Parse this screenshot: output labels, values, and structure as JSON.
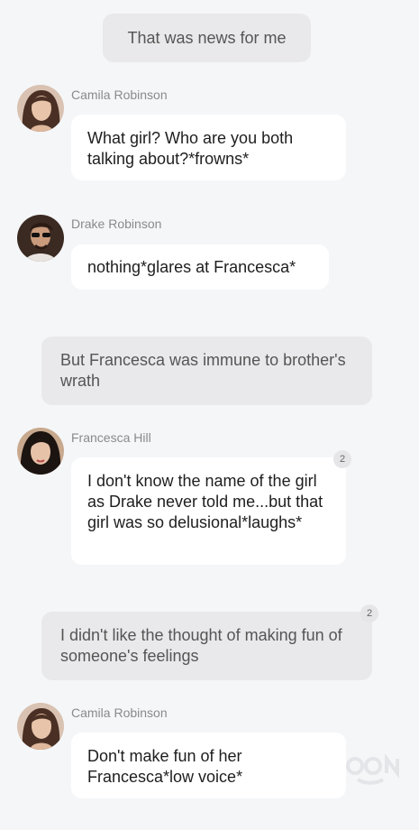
{
  "messages": [
    {
      "type": "narration",
      "text": "That was news for me"
    },
    {
      "type": "chat",
      "author": "Camila Robinson",
      "avatar": "camila-avatar",
      "text": "What girl? Who are you both talking about?*frowns*"
    },
    {
      "type": "chat",
      "author": "Drake Robinson",
      "avatar": "drake-avatar",
      "text": "nothing*glares at Francesca*"
    },
    {
      "type": "narration",
      "text": "But Francesca was immune to brother's wrath"
    },
    {
      "type": "chat",
      "author": "Francesca Hill",
      "avatar": "francesca-avatar",
      "text": "I don't know the name of the girl as Drake never told me...but that girl was so delusional*laughs*",
      "comment_count": "2"
    },
    {
      "type": "narration",
      "text": "I didn't like the thought of making fun of someone's feelings",
      "comment_count": "2"
    },
    {
      "type": "chat",
      "author": "Camila Robinson",
      "avatar": "camila-avatar",
      "text": "Don't make fun of her Francesca*low voice*"
    }
  ],
  "colors": {
    "background": "#f5f6f8",
    "narration_bg": "#e9e9eb",
    "bubble_bg": "#ffffff",
    "name_text": "#8a8a8e"
  }
}
